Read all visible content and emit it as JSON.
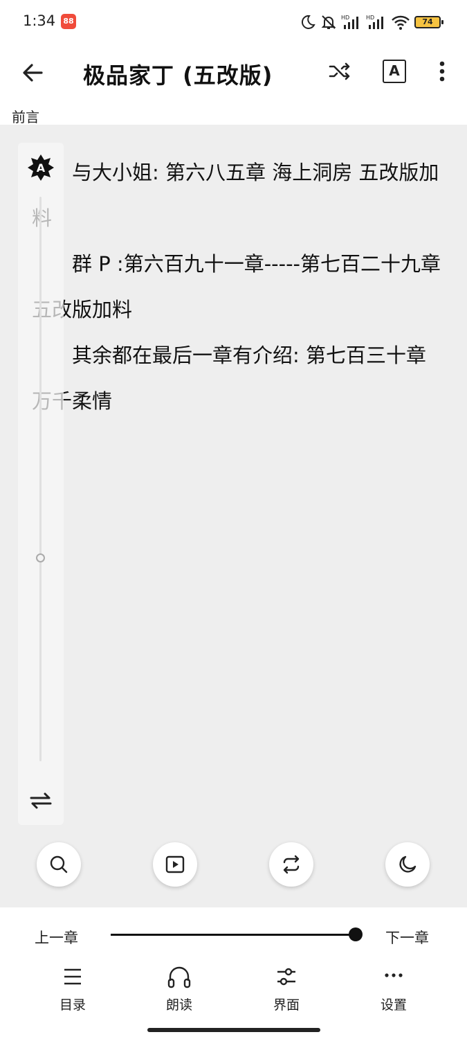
{
  "status": {
    "time": "1:34",
    "battery": "74"
  },
  "header": {
    "title": "极品家丁 (五改版)",
    "font_button": "A"
  },
  "chapter": {
    "label": "前言"
  },
  "content": {
    "paragraphs": [
      "与大小姐: 第六八五章  海上洞房  五改版加料",
      "群 P :第六百九十一章-----第七百二十九章 五改版加料",
      "其余都在最后一章有介绍: 第七百三十章 万千柔情"
    ]
  },
  "brightness": {
    "auto_icon_letter": "A",
    "level": 0.36
  },
  "footer": {
    "prev_chapter": "上一章",
    "next_chapter": "下一章",
    "progress": 1.0,
    "nav": [
      {
        "label": "目录",
        "icon": "list-icon"
      },
      {
        "label": "朗读",
        "icon": "headphones-icon"
      },
      {
        "label": "界面",
        "icon": "sliders-icon"
      },
      {
        "label": "设置",
        "icon": "more-horizontal-icon"
      }
    ]
  },
  "colors": {
    "reader_background": "#eeeeee",
    "text": "#111111",
    "accent": "#111111"
  }
}
